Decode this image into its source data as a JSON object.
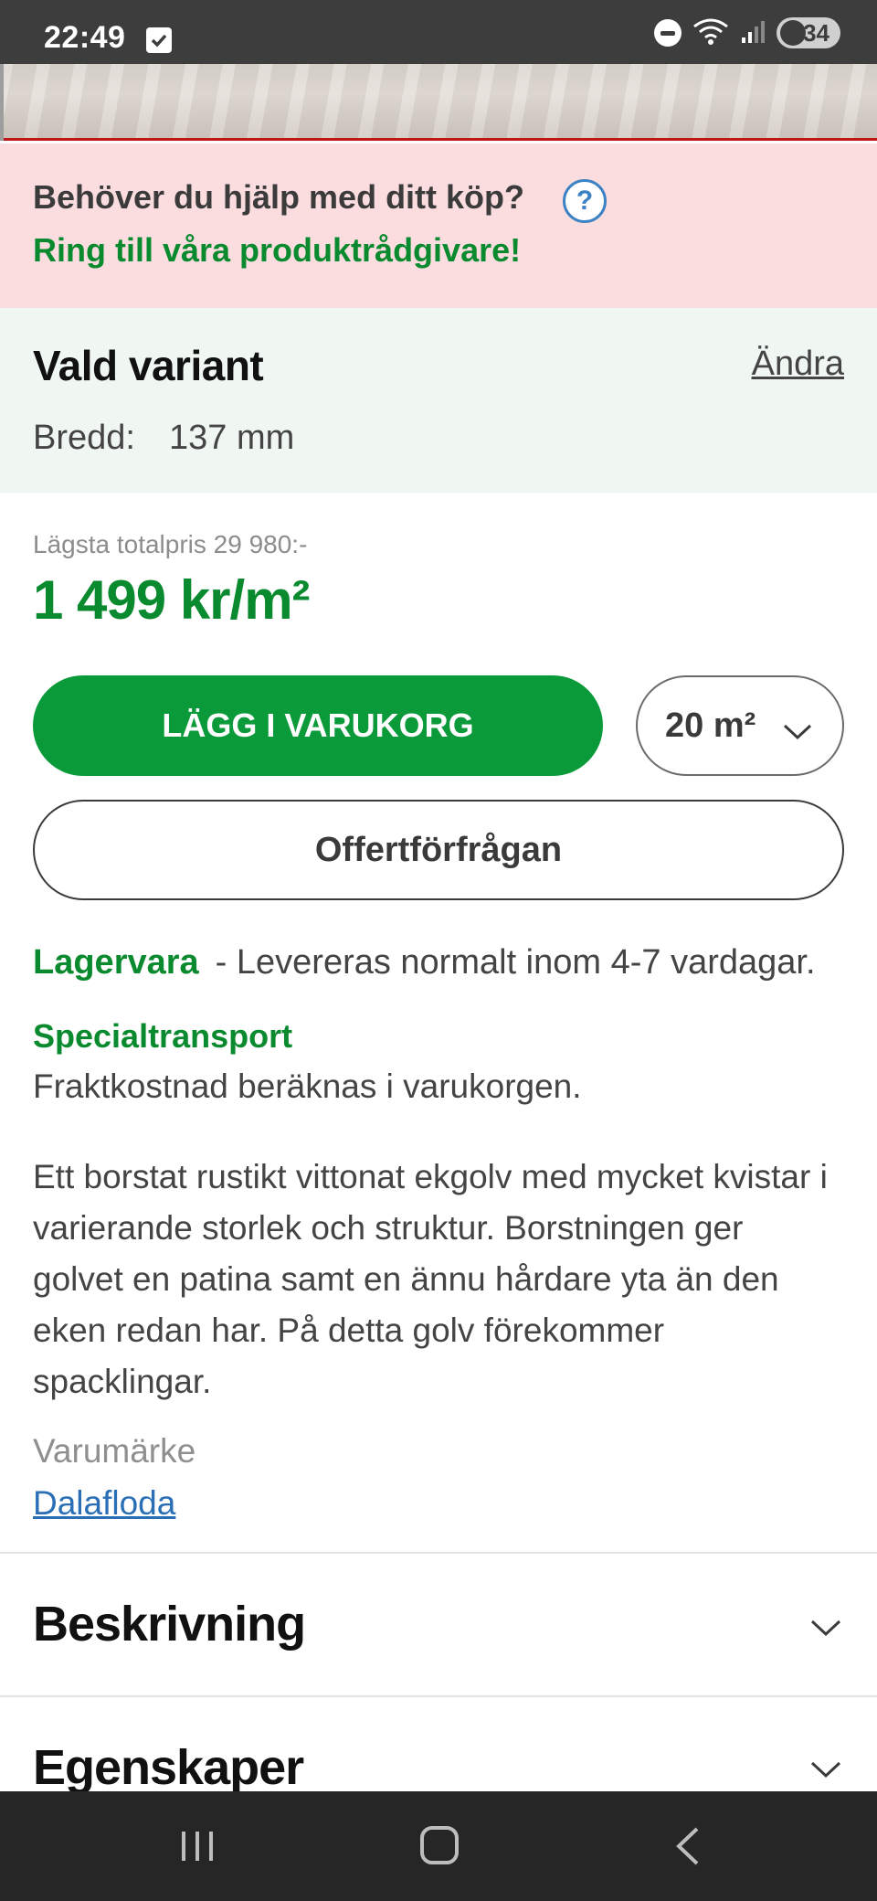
{
  "status_bar": {
    "time": "22:49",
    "battery": "34",
    "network": "6E"
  },
  "help_banner": {
    "question": "Behöver du hjälp med ditt köp?",
    "help_icon": "?",
    "call_text": "Ring till våra produktrådgivare!"
  },
  "variant": {
    "title": "Vald variant",
    "change_label": "Ändra",
    "attribute_label": "Bredd:",
    "attribute_value": "137 mm"
  },
  "price": {
    "lowest_total": "Lägsta totalpris 29 980:-",
    "price_per_unit": "1 499 kr/m²"
  },
  "actions": {
    "add_to_cart": "LÄGG I VARUKORG",
    "quantity": "20 m²",
    "quote_request": "Offertförfrågan"
  },
  "stock": {
    "status": "Lagervara",
    "delivery": "- Levereras normalt inom 4-7 vardagar."
  },
  "shipping": {
    "title": "Specialtransport",
    "note": "Fraktkostnad beräknas i varukorgen."
  },
  "description": "Ett borstat rustikt vittonat ekgolv med mycket kvistar i varierande storlek och struktur. Borstningen ger golvet en patina samt en ännu hårdare yta än den eken redan har. På detta golv förekommer spacklingar.",
  "brand": {
    "label": "Varumärke",
    "name": "Dalafloda"
  },
  "sections": {
    "description": "Beskrivning",
    "properties": "Egenskaper"
  },
  "colors": {
    "accent_green": "#0b9a3a",
    "banner_pink": "#fbdde0",
    "variant_bg": "#f0f6f2",
    "link_blue": "#2a6fb5"
  }
}
